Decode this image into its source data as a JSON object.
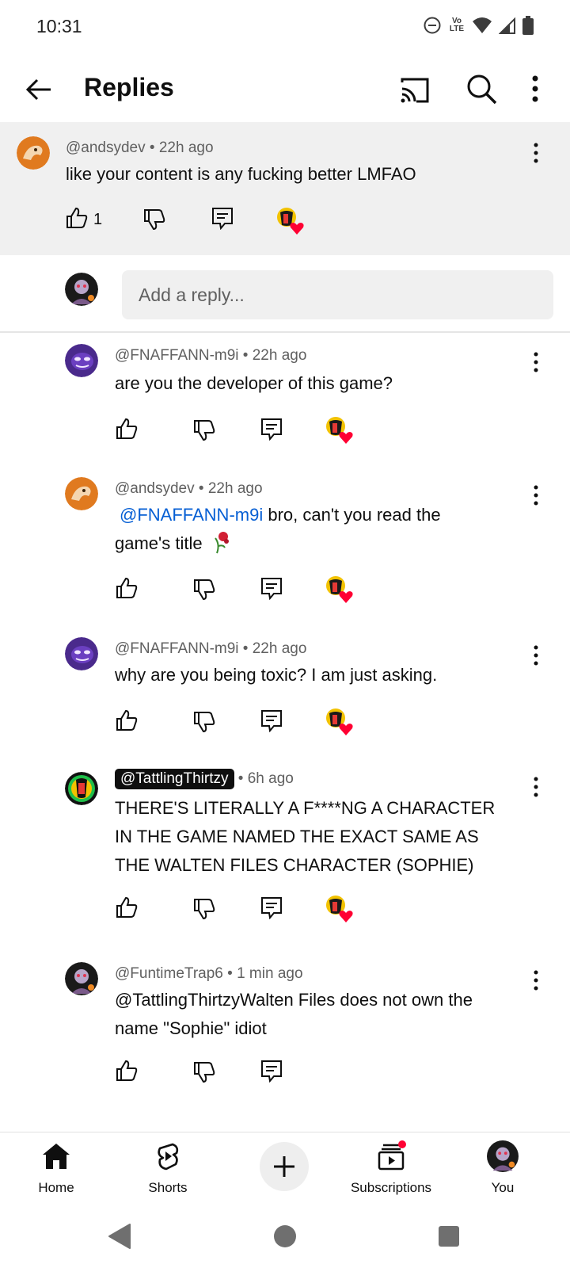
{
  "status_bar": {
    "time": "10:31",
    "network": "LTE"
  },
  "app_bar": {
    "title": "Replies"
  },
  "parent_comment": {
    "author": "@andsydev",
    "time": "22h ago",
    "text": "like your content is any fucking better LMFAO",
    "likes": "1"
  },
  "reply_input": {
    "placeholder": "Add a reply..."
  },
  "replies": [
    {
      "author": "@FNAFFANN-m9i",
      "time": "22h ago",
      "text": "are you the developer of this game?"
    },
    {
      "author": "@andsydev",
      "time": "22h ago",
      "mention": "@FNAFFANN-m9i",
      "text_line1": " bro, can't you read the",
      "text_line2": "game's title"
    },
    {
      "author": "@FNAFFANN-m9i",
      "time": "22h ago",
      "text": "why are you being toxic? I am just asking."
    },
    {
      "author": "@TattlingThirtzy",
      "time": "6h ago",
      "text_lines": [
        "THERE'S LITERALLY A F****NG A CHARACTER",
        "IN THE GAME NAMED THE EXACT SAME AS",
        "THE WALTEN FILES CHARACTER (SOPHIE)"
      ]
    },
    {
      "author": "@FuntimeTrap6",
      "time": "1 min ago",
      "text_lines": [
        "@TattlingThirtzyWalten Files does not own the",
        "name \"Sophie\" idiot"
      ]
    }
  ],
  "bottom_nav": {
    "home": "Home",
    "shorts": "Shorts",
    "subscriptions": "Subscriptions",
    "you": "You"
  },
  "colors": {
    "accent_red": "#ff0033",
    "link_blue": "#065fd4",
    "surface_grey": "#f0f0f0"
  }
}
